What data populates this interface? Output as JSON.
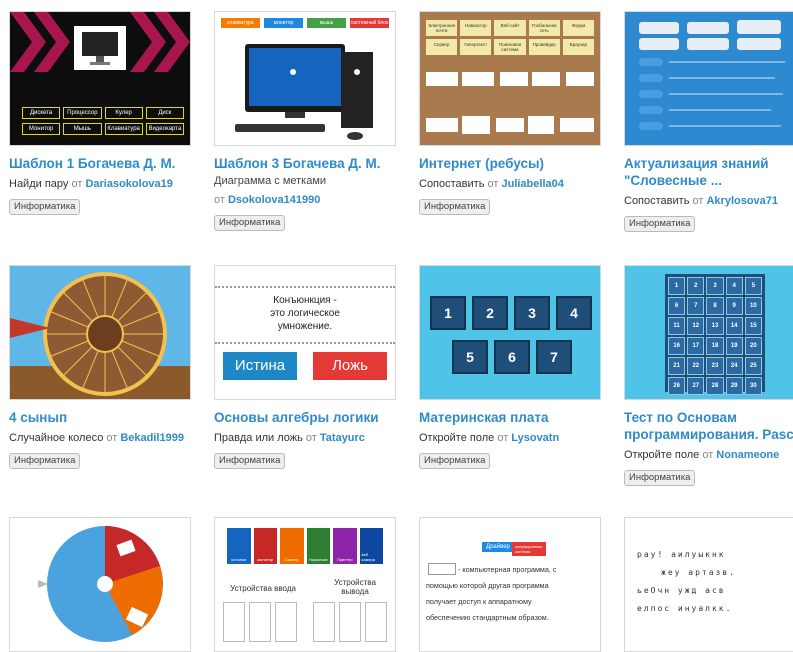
{
  "cards": [
    {
      "title": "Шаблон 1 Богачева Д. М.",
      "type": "Найди пару",
      "from": "от",
      "author": "Dariasokolova19",
      "tag": "Информатика",
      "thumb_labels": [
        "Дискета",
        "Процессор",
        "Кулер",
        "Диск",
        "Монитор",
        "Мышь",
        "Клавиатура",
        "Видеокарта"
      ]
    },
    {
      "title": "Шаблон 3 Богачева Д. М.",
      "type": "Диаграмма с метками",
      "from": "от",
      "author": "Dsokolova141990",
      "tag": "Информатика",
      "thumb_labels": [
        "клавиатура",
        "монитор",
        "мышь",
        "системный блок"
      ]
    },
    {
      "title": "Интернет (ребусы)",
      "type": "Сопоставить",
      "from": "от",
      "author": "Juliabella04",
      "tag": "Информатика",
      "thumb_labels": [
        "Электронная почта",
        "Навигатор",
        "Веб-сайт",
        "Глобальная сеть",
        "Форум",
        "Сервер",
        "Гипертекст",
        "Поисковая система",
        "Провайдер",
        "Браузер"
      ]
    },
    {
      "title": "Актуализация знаний \"Словесные ...",
      "type": "Сопоставить",
      "from": "от",
      "author": "Akrylosova71",
      "tag": "Информатика"
    },
    {
      "title": "4 сынып",
      "type": "Случайное колесо",
      "from": "от",
      "author": "Bekadil1999",
      "tag": "Информатика"
    },
    {
      "title": "Основы алгебры логики",
      "type": "Правда или ложь",
      "from": "от",
      "author": "Tatayurc",
      "tag": "Информатика",
      "thumb_statement": [
        "Конъюнкция -",
        "это логическое",
        "умножение."
      ],
      "thumb_true": "Истина",
      "thumb_false": "Ложь"
    },
    {
      "title": "Материнская плата",
      "type": "Откройте поле",
      "from": "от",
      "author": "Lysovatn",
      "tag": "Информатика",
      "thumb_numbers": [
        "1",
        "2",
        "3",
        "4",
        "5",
        "6",
        "7"
      ]
    },
    {
      "title": "Тест по Основам программирования. Pascal",
      "type": "Откройте поле",
      "from": "от",
      "author": "Nonameone",
      "tag": "Информатика",
      "thumb_numbers": [
        "1",
        "2",
        "3",
        "4",
        "5",
        "6",
        "7",
        "8",
        "9",
        "10",
        "11",
        "12",
        "13",
        "14",
        "15",
        "16",
        "17",
        "18",
        "19",
        "20",
        "21",
        "22",
        "23",
        "24",
        "25",
        "26",
        "27",
        "28",
        "29",
        "30"
      ]
    },
    {
      "title": "",
      "thumb_labels": []
    },
    {
      "title": "",
      "thumb_labels": [
        "колонки",
        "монитор",
        "Сканер",
        "Наушники",
        "Принтер",
        "веб камера"
      ],
      "thumb_headings": [
        "Устройства ввода",
        "Устройства вывода"
      ]
    },
    {
      "title": "",
      "thumb_tags": [
        "Драйвер",
        "операционная система"
      ],
      "thumb_text": [
        "- компьютерная программа, с",
        "помощью которой другая программа",
        "получает доступ к аппаратному",
        "обеспечению стандартным образом."
      ]
    },
    {
      "title": "",
      "thumb_scramble": [
        "рау! аилуыкнк",
        "жеу артазв.",
        "ьеОчн ужд асв",
        "елпос инуалкк."
      ]
    }
  ],
  "colors": {
    "link": "#2f8bc9",
    "tag_bg": "#eeeeee"
  }
}
